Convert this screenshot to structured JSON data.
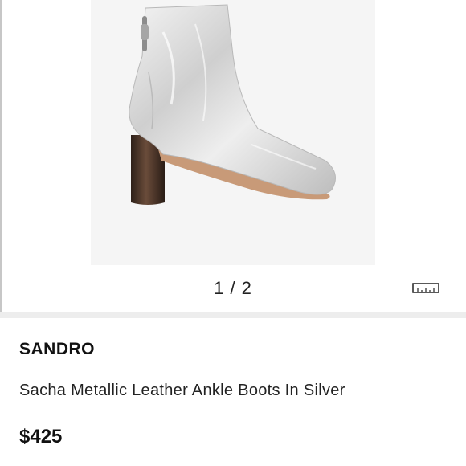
{
  "product": {
    "image_alt": "Silver metallic leather ankle boot",
    "pager": "1 / 2",
    "brand": "SANDRO",
    "title": "Sacha Metallic Leather Ankle Boots In Silver",
    "price": "$425",
    "size_guide_icon": "ruler-icon"
  },
  "colors": {
    "boot_silver": "#d9d9d9",
    "heel_brown": "#4a3426",
    "divider": "#ededed"
  }
}
